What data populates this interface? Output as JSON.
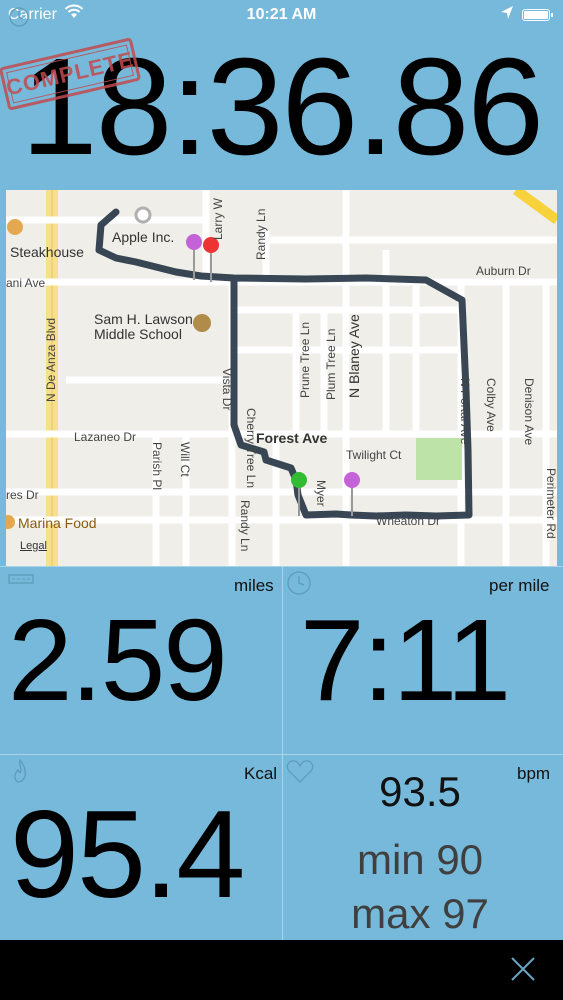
{
  "status_bar": {
    "carrier": "Carrier",
    "time": "10:21 AM"
  },
  "workout": {
    "stamp": "COMPLETE",
    "elapsed": "18:36.86",
    "distance": {
      "value": "2.59",
      "unit": "miles",
      "icon": "road-icon"
    },
    "pace": {
      "value": "7:11",
      "unit": "per mile",
      "icon": "stopwatch-icon"
    },
    "calories": {
      "value": "95.4",
      "unit": "Kcal",
      "icon": "flame-icon"
    },
    "heart_rate": {
      "current": "93.5",
      "min": "min 90",
      "max": "max 97",
      "unit": "bpm",
      "icon": "heart-icon"
    }
  },
  "map": {
    "labels": {
      "steakhouse": "Steakhouse",
      "apple": "Apple Inc.",
      "mani_ave": "ani Ave",
      "larry_way": "Larry W",
      "randy_ln_top": "Randy Ln",
      "auburn": "Auburn Dr",
      "lawson_1": "Sam H. Lawson",
      "lawson_2": "Middle School",
      "de_anza": "N De Anza Blvd",
      "cherry_tree": "Cherry Tree Ln",
      "prune_tree": "Prune Tree Ln",
      "plum_tree": "Plum Tree Ln",
      "blaney": "N Blaney Ave",
      "vista": "Vista Dr",
      "portal": "N Portal Ave",
      "colby": "Colby Ave",
      "denison": "Denison Ave",
      "lazaneo": "Lazaneo Dr",
      "forest": "Forest Ave",
      "twilight": "Twilight Ct",
      "parish": "Parish Pl",
      "will_ct": "Will Ct",
      "randy_ln_bottom": "Randy Ln",
      "myer": "Myer",
      "wheaton": "Wheaton Dr",
      "perimeter": "Perimeter Rd",
      "res_dr": "res Dr",
      "marina": "Marina Food",
      "legal": "Legal"
    }
  },
  "colors": {
    "background": "#76b9da",
    "route": "#233344",
    "stamp": "#c24b50"
  }
}
